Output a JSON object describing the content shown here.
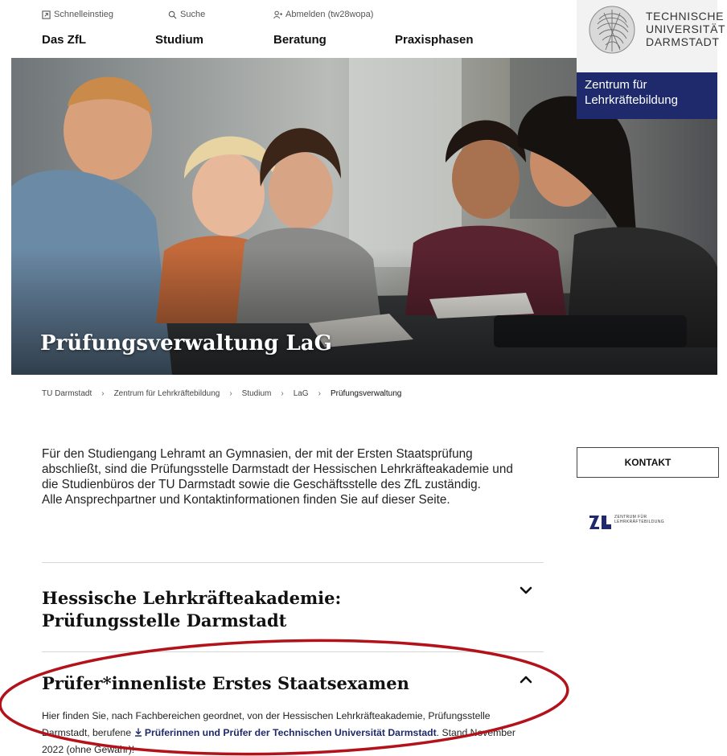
{
  "header": {
    "utility": {
      "quick_access": "Schnelleinstieg",
      "search": "Suche",
      "logout": "Abmelden (tw28wopa)"
    },
    "nav": [
      "Das ZfL",
      "Studium",
      "Beratung",
      "Praxisphasen"
    ],
    "logo": {
      "line1": "TECHNISCHE",
      "line2": "UNIVERSITÄT",
      "line3": "DARMSTADT"
    },
    "institute": "Zentrum für Lehrkräftebildung"
  },
  "hero": {
    "title": "Prüfungsverwaltung LaG"
  },
  "breadcrumb": [
    "TU Darmstadt",
    "Zentrum für Lehrkräftebildung",
    "Studium",
    "LaG",
    "Prüfungsverwaltung"
  ],
  "intro": {
    "text": "Für den Studiengang Lehramt an Gymnasien, der mit der Ersten Staatsprüfung abschließt, sind die Prüfungsstelle Darmstadt der Hessischen Lehrkräfteakademie und die Studienbüros der TU Darmstadt sowie die Geschäftsstelle des ZfL zuständig.",
    "text2": "Alle Ansprechpartner und Kontaktinformationen finden Sie auf dieser Seite."
  },
  "sidebar": {
    "contact_label": "KONTAKT",
    "zfl_logo_line1": "ZENTRUM FÜR",
    "zfl_logo_line2": "LEHRKRÄFTEBILDUNG"
  },
  "accordion": [
    {
      "title_line1": "Hessische Lehrkräfteakademie:",
      "title_line2": "Prüfungsstelle Darmstadt",
      "expanded": false
    },
    {
      "title": "Prüfer*innenliste Erstes Staatsexamen",
      "expanded": true,
      "body_prefix": "Hier finden Sie, nach Fachbereichen geordnet, von der Hessischen Lehrkräfteakademie, Prüfungsstelle Darmstadt, berufene",
      "link": "Prüferinnen und Prüfer der Technischen Universität Darmstadt",
      "body_suffix": ". Stand November 2022 (ohne Gewähr)!"
    }
  ],
  "colors": {
    "brand_navy": "#1e2a6b",
    "annotation_red": "#b3121b"
  }
}
